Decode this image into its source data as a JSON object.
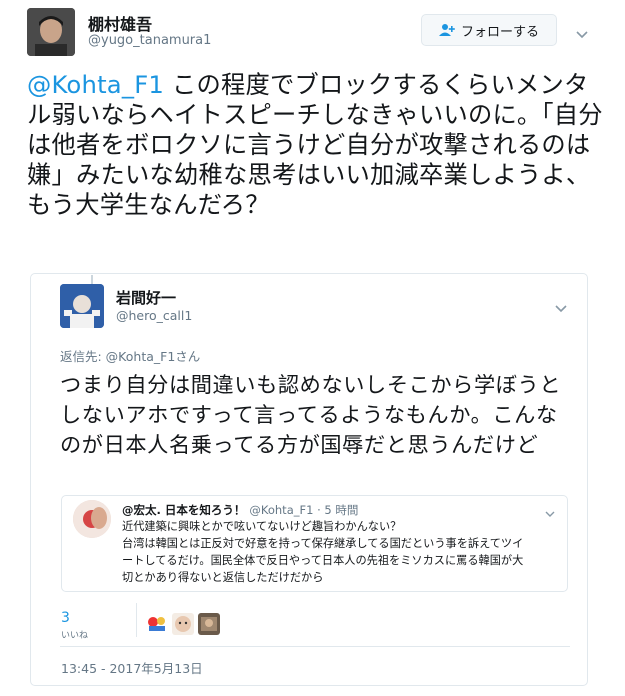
{
  "tweet": {
    "author_name": "棚村雄吾",
    "author_handle": "@yugo_tanamura1",
    "follow_label": "フォローする",
    "mention": "@Kohta_F1",
    "body": " この程度でブロックするくらいメンタル弱いならヘイトスピーチしなきゃいいのに。「自分は他者をボロクソに言うけど自分が攻撃されるのは嫌」みたいな幼稚な思考はいい加減卒業しようよ、もう大学生なんだろ？"
  },
  "quoted": {
    "author_name": "岩間好一",
    "author_handle": "@hero_call1",
    "reply_to": "返信先: @Kohta_F1さん",
    "body": "つまり自分は間違いも認めないしそこから学ぼうとしないアホですって言ってるようなもんか。こんなのが日本人名乗ってる方が国辱だと思うんだけど",
    "nested": {
      "author_name": "@宏太. 日本を知ろう！",
      "meta": "@Kohta_F1 · 5 時間",
      "lines": [
        "近代建築に興味とかで呟いてないけど趣旨わかんない？",
        "台湾は韓国とは正反対で好意を持って保存継承してる国だという事を訴えてツイ",
        "ートしてるだけ。国民全体で反日やって日本人の先祖をミソカスに罵る韓国が大",
        "切とかあり得ないと返信しただけだから"
      ]
    },
    "likes_count": "3",
    "likes_label": "いいね",
    "timestamp": "13:45 - 2017年5月13日"
  },
  "colors": {
    "accent": "#1b95e0",
    "muted": "#657786",
    "border": "#e1e8ed"
  }
}
